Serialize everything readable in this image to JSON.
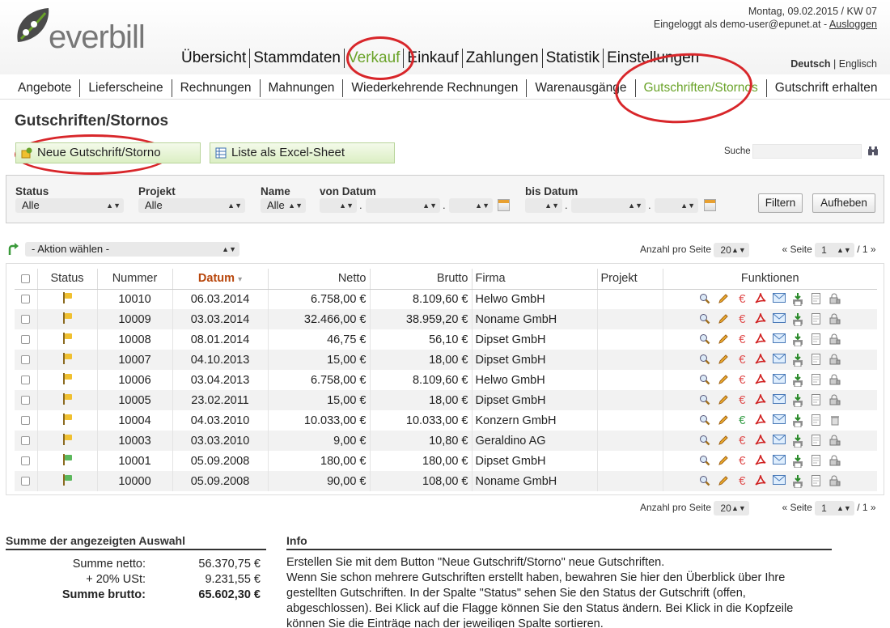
{
  "header": {
    "logo_text": "everbill",
    "date_line": "Montag, 09.02.2015 / KW 07",
    "logged_in_prefix": "Eingeloggt als demo-user@epunet.at -",
    "logout_label": "Ausloggen",
    "lang_active": "Deutsch",
    "lang_other": "Englisch"
  },
  "mainnav": [
    "Übersicht",
    "Stammdaten",
    "Verkauf",
    "Einkauf",
    "Zahlungen",
    "Statistik",
    "Einstellungen"
  ],
  "subnav": [
    "Angebote",
    "Lieferscheine",
    "Rechnungen",
    "Mahnungen",
    "Wiederkehrende Rechnungen",
    "Warenausgänge",
    "Gutschriften/Stornos",
    "Gutschrift erhalten"
  ],
  "page": {
    "title": "Gutschriften/Stornos",
    "new_button": "Neue Gutschrift/Storno",
    "excel_button": "Liste als Excel-Sheet",
    "search_label": "Suche"
  },
  "filters": {
    "status_label": "Status",
    "status_value": "Alle",
    "projekt_label": "Projekt",
    "projekt_value": "Alle",
    "name_label": "Name",
    "name_value": "Alle",
    "von_label": "von Datum",
    "bis_label": "bis Datum",
    "dot": ".",
    "filter_btn": "Filtern",
    "reset_btn": "Aufheben"
  },
  "actions": {
    "select_label": "- Aktion wählen -"
  },
  "pager": {
    "per_page_label": "Anzahl pro Seite",
    "per_page_value": "20",
    "seite_label": "« Seite",
    "page_value": "1",
    "total": "/ 1 »"
  },
  "table": {
    "headers": {
      "status": "Status",
      "nummer": "Nummer",
      "datum": "Datum",
      "sort_arrow": "▾",
      "netto": "Netto",
      "brutto": "Brutto",
      "firma": "Firma",
      "projekt": "Projekt",
      "funktionen": "Funktionen"
    },
    "rows": [
      {
        "nummer": "10010",
        "datum": "06.03.2014",
        "netto": "6.758,00 €",
        "brutto": "8.109,60 €",
        "firma": "Helwo GmbH",
        "status_color": "#f0c030",
        "euro_color": "#e05050",
        "last_icon": "bag"
      },
      {
        "nummer": "10009",
        "datum": "03.03.2014",
        "netto": "32.466,00 €",
        "brutto": "38.959,20 €",
        "firma": "Noname GmbH",
        "status_color": "#f0c030",
        "euro_color": "#e05050",
        "last_icon": "bag"
      },
      {
        "nummer": "10008",
        "datum": "08.01.2014",
        "netto": "46,75 €",
        "brutto": "56,10 €",
        "firma": "Dipset GmbH",
        "status_color": "#f0c030",
        "euro_color": "#e05050",
        "last_icon": "bag"
      },
      {
        "nummer": "10007",
        "datum": "04.10.2013",
        "netto": "15,00 €",
        "brutto": "18,00 €",
        "firma": "Dipset GmbH",
        "status_color": "#f0c030",
        "euro_color": "#e05050",
        "last_icon": "bag"
      },
      {
        "nummer": "10006",
        "datum": "03.04.2013",
        "netto": "6.758,00 €",
        "brutto": "8.109,60 €",
        "firma": "Helwo GmbH",
        "status_color": "#f0c030",
        "euro_color": "#e05050",
        "last_icon": "bag"
      },
      {
        "nummer": "10005",
        "datum": "23.02.2011",
        "netto": "15,00 €",
        "brutto": "18,00 €",
        "firma": "Dipset GmbH",
        "status_color": "#f0c030",
        "euro_color": "#e05050",
        "last_icon": "bag"
      },
      {
        "nummer": "10004",
        "datum": "04.03.2010",
        "netto": "10.033,00 €",
        "brutto": "10.033,00 €",
        "firma": "Konzern GmbH",
        "status_color": "#f0c030",
        "euro_color": "#3aa04a",
        "last_icon": "trash"
      },
      {
        "nummer": "10003",
        "datum": "03.03.2010",
        "netto": "9,00 €",
        "brutto": "10,80 €",
        "firma": "Geraldino AG",
        "status_color": "#f0c030",
        "euro_color": "#e05050",
        "last_icon": "bag"
      },
      {
        "nummer": "10001",
        "datum": "05.09.2008",
        "netto": "180,00 €",
        "brutto": "180,00 €",
        "firma": "Dipset GmbH",
        "status_color": "#5cb85c",
        "euro_color": "#e05050",
        "last_icon": "bag"
      },
      {
        "nummer": "10000",
        "datum": "05.09.2008",
        "netto": "90,00 €",
        "brutto": "108,00 €",
        "firma": "Noname GmbH",
        "status_color": "#5cb85c",
        "euro_color": "#e05050",
        "last_icon": "bag"
      }
    ]
  },
  "summe": {
    "title": "Summe der angezeigten Auswahl",
    "netto_label": "Summe netto:",
    "netto_value": "56.370,75 €",
    "ust_label": "+ 20% USt:",
    "ust_value": "9.231,55 €",
    "brutto_label": "Summe brutto:",
    "brutto_value": "65.602,30 €"
  },
  "info": {
    "title": "Info",
    "line1": "Erstellen Sie mit dem Button \"Neue Gutschrift/Storno\" neue Gutschriften.",
    "line2": "Wenn Sie schon mehrere Gutschriften erstellt haben, bewahren Sie hier den Überblick über Ihre gestellten Gutschriften. In der Spalte \"Status\" sehen Sie den Status der Gutschrift (offen, abgeschlossen). Bei Klick auf die Flagge können Sie den Status ändern. Bei Klick in die Kopfzeile können Sie die Einträge nach der jeweiligen Spalte sortieren."
  },
  "colors": {
    "accent_green": "#6aa329",
    "highlight_red": "#d8262a",
    "sort_header": "#b8460b"
  }
}
